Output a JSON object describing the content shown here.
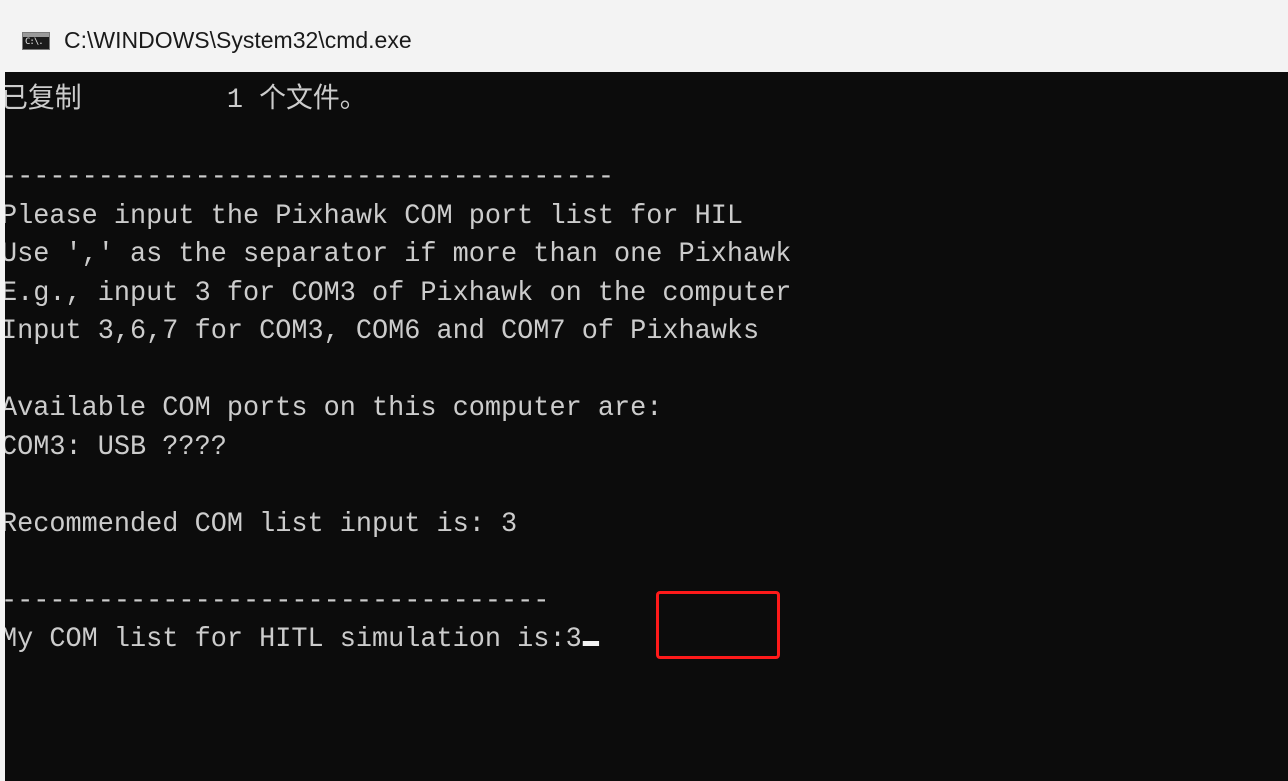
{
  "window": {
    "title": "C:\\WINDOWS\\System32\\cmd.exe",
    "icon": "cmd-console-icon",
    "icon_glyph": "C:\\."
  },
  "console": {
    "background": "#0c0c0c",
    "foreground": "#cccccc",
    "lines": [
      "已复制         1 个文件。",
      "",
      "--------------------------------------",
      "Please input the Pixhawk COM port list for HIL",
      "Use ',' as the separator if more than one Pixhawk",
      "E.g., input 3 for COM3 of Pixhawk on the computer",
      "Input 3,6,7 for COM3, COM6 and COM7 of Pixhawks",
      "",
      "Available COM ports on this computer are:",
      "COM3: USB ????",
      "",
      "Recommended COM list input is: 3",
      "",
      "----------------------------------",
      "My COM list for HITL simulation is:"
    ],
    "prompt_input": "3"
  },
  "annotation": {
    "highlight_color": "#ff1a1a"
  }
}
